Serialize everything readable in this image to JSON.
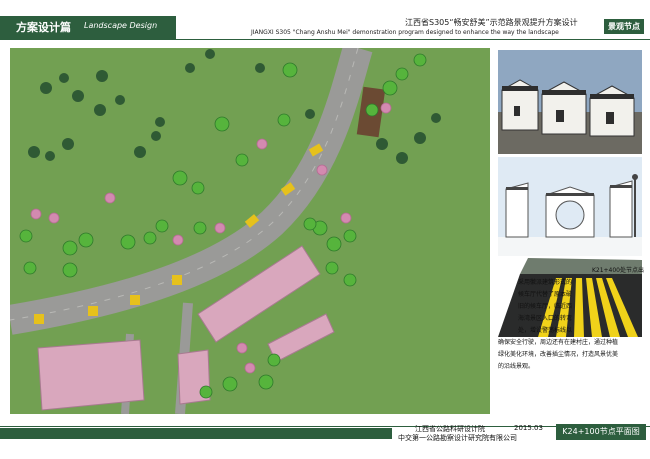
{
  "header": {
    "section_title": "方案设计篇",
    "section_subtitle": "Landscape Design",
    "project_title_cn": "江西省S305“畅安舒美”示范路景观提升方案设计",
    "project_title_en": "JIANGXI S305 \"Chang Anshu Mei\" demonstration program designed to enhance the way the landscape",
    "tag": "景观节点"
  },
  "description": {
    "lines": [
      "K21+400处节点出",
      "采用徽派建筑形式的",
      "候车厅代替了原本破",
      "旧的候车厅，临近西",
      "海湾景区入口的转弯",
      "处，增设警荡标线以",
      "确保安全行驶，周边还有在建村庄，通过种植",
      "绿化美化环境，改善插尘情况，打造风景优美",
      "的沿线景观。"
    ]
  },
  "footer": {
    "org1": "江西省公路科研设计院",
    "org2": "中交第一公路勘察设计研究院有限公司",
    "date": "2015.03",
    "drawing_title": "K24+100节点平面图"
  },
  "colors": {
    "brand_green": "#2d5e3e",
    "grass": "#6e9c4f",
    "road": "#9a9a98",
    "marking": "#e6c11c"
  }
}
